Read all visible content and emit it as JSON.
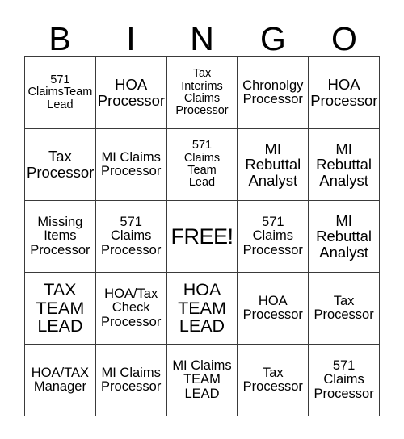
{
  "header": {
    "letters": [
      "B",
      "I",
      "N",
      "G",
      "O"
    ]
  },
  "grid": {
    "rows": [
      [
        {
          "text": "571\nClaimsTeam\nLead",
          "size": "xs"
        },
        {
          "text": "HOA\nProcessor",
          "size": "m"
        },
        {
          "text": "Tax\nInterims\nClaims\nProcessor",
          "size": "xs"
        },
        {
          "text": "Chronolgy\nProcessor",
          "size": "s"
        },
        {
          "text": "HOA\nProcessor",
          "size": "m"
        }
      ],
      [
        {
          "text": "Tax\nProcessor",
          "size": "m"
        },
        {
          "text": "MI Claims\nProcessor",
          "size": "s"
        },
        {
          "text": "571\nClaims\nTeam\nLead",
          "size": "xs"
        },
        {
          "text": "MI\nRebuttal\nAnalyst",
          "size": "m"
        },
        {
          "text": "MI\nRebuttal\nAnalyst",
          "size": "m"
        }
      ],
      [
        {
          "text": "Missing\nItems\nProcessor",
          "size": "s"
        },
        {
          "text": "571\nClaims\nProcessor",
          "size": "s"
        },
        {
          "text": "FREE!",
          "size": "free"
        },
        {
          "text": "571\nClaims\nProcessor",
          "size": "s"
        },
        {
          "text": "MI\nRebuttal\nAnalyst",
          "size": "m"
        }
      ],
      [
        {
          "text": "TAX\nTEAM\nLEAD",
          "size": "l"
        },
        {
          "text": "HOA/Tax\nCheck\nProcessor",
          "size": "s"
        },
        {
          "text": "HOA\nTEAM\nLEAD",
          "size": "l"
        },
        {
          "text": "HOA\nProcessor",
          "size": "s"
        },
        {
          "text": "Tax\nProcessor",
          "size": "s"
        }
      ],
      [
        {
          "text": "HOA/TAX\nManager",
          "size": "s"
        },
        {
          "text": "MI Claims\nProcessor",
          "size": "s"
        },
        {
          "text": "MI Claims\nTEAM\nLEAD",
          "size": "s"
        },
        {
          "text": "Tax\nProcessor",
          "size": "s"
        },
        {
          "text": "571\nClaims\nProcessor",
          "size": "s"
        }
      ]
    ]
  },
  "colors": {
    "background": "#ffffff",
    "text": "#000000",
    "border": "#3a3a3a"
  }
}
